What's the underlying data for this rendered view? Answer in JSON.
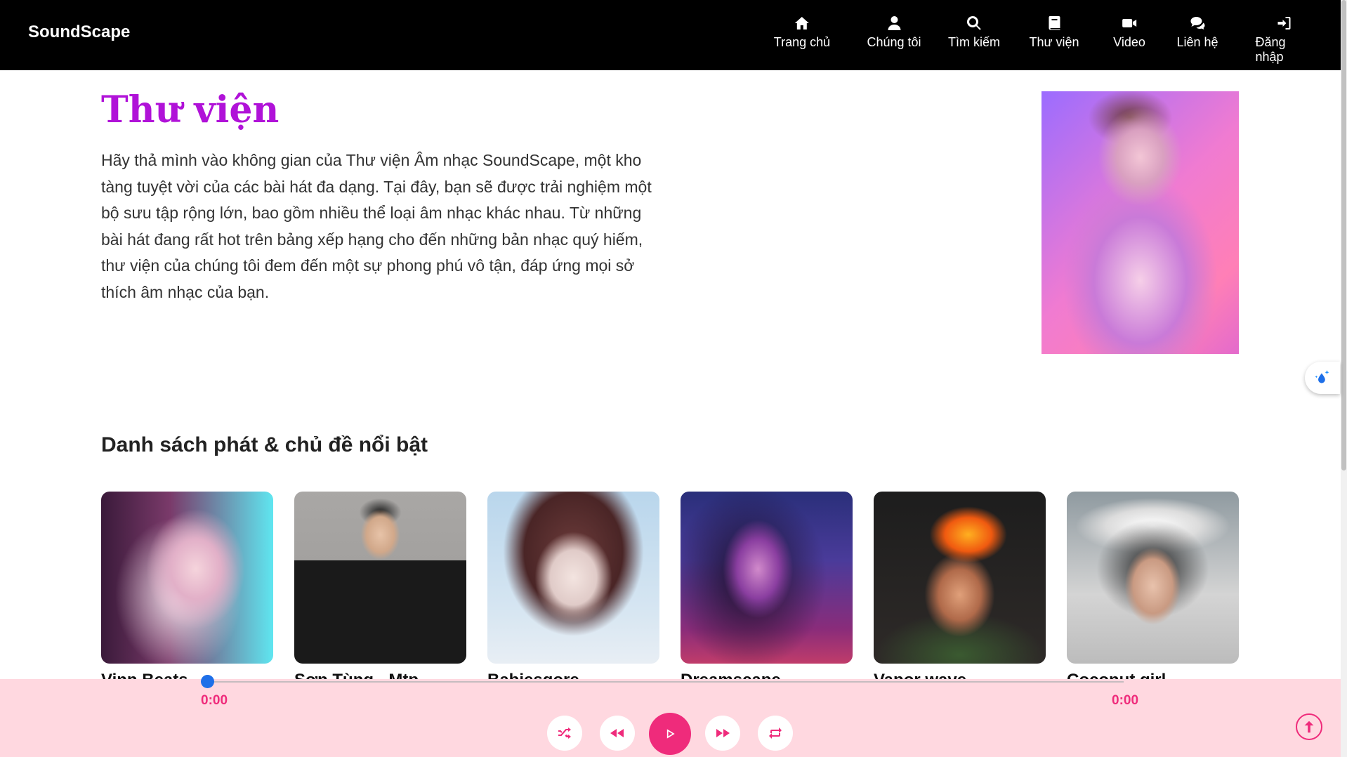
{
  "header": {
    "brand": "SoundScape",
    "nav": [
      {
        "label": "Trang chủ",
        "icon": "home-icon"
      },
      {
        "label": "Chúng tôi",
        "icon": "user-icon"
      },
      {
        "label": "Tìm kiếm",
        "icon": "search-icon"
      },
      {
        "label": "Thư viện",
        "icon": "book-icon"
      },
      {
        "label": "Video",
        "icon": "video-icon"
      },
      {
        "label": "Liên hệ",
        "icon": "chat-icon"
      },
      {
        "label": "Đăng nhập",
        "icon": "login-icon"
      }
    ]
  },
  "hero": {
    "title": "Thư viện",
    "text": "Hãy thả mình vào không gian của Thư viện Âm nhạc SoundScape, một kho tàng tuyệt vời của các bài hát đa dạng. Tại đây, bạn sẽ được trải nghiệm một bộ sưu tập rộng lớn, bao gồm nhiều thể loại âm nhạc khác nhau. Từ những bài hát đang rất hot trên bảng xếp hạng cho đến những bản nhạc quý hiếm, thư viện của chúng tôi đem đến một sự phong phú vô tận, đáp ứng mọi sở thích âm nhạc của bạn."
  },
  "playlists": {
    "title": "Danh sách phát & chủ đề nổi bật",
    "items": [
      {
        "name": "Vinn Beats"
      },
      {
        "name": "Sơn Tùng - Mtp"
      },
      {
        "name": "Babiesgore"
      },
      {
        "name": "Dreamscape"
      },
      {
        "name": "Vapor wave"
      },
      {
        "name": "Coconut girl"
      }
    ]
  },
  "player": {
    "current_time": "0:00",
    "duration": "0:00",
    "progress": 0
  },
  "colors": {
    "accent": "#b012d8",
    "player_accent": "#ef2b7b",
    "player_bg": "#ffd8e0"
  }
}
